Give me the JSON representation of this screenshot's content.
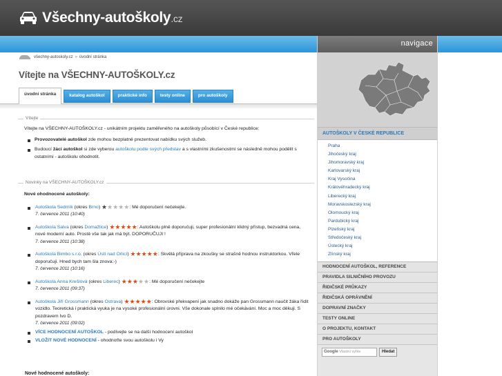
{
  "site": {
    "name": "Všechny-autoškoly",
    "tld": ".cz"
  },
  "colors": {
    "accent_blue": "#2c95d8",
    "link": "#2a78b8",
    "star_on": "#e04a10",
    "header_dark": "#3a3a3a"
  },
  "breadcrumb": {
    "home": "všechny-autoskoly.cz",
    "separator": "»",
    "current": "úvodní stránka"
  },
  "page_title": "Vítejte na VŠECHNY-AUTOŠKOLY.cz",
  "tabs": [
    {
      "label": "úvodní stránka",
      "active": true
    },
    {
      "label": "katalog autoškol",
      "active": false
    },
    {
      "label": "praktické info",
      "active": false
    },
    {
      "label": "testy online",
      "active": false
    },
    {
      "label": "pro autoškoly",
      "active": false
    }
  ],
  "welcome": {
    "legend": "Vítejte",
    "intro": "Vítejte na VŠECHNY-AUTOŠKOLY.cz - unikátním projektu zaměřeného na autoškoly působící v České republice:",
    "bullet1": {
      "bold": "Provozovatelé autoškol",
      "rest": " zde mohou bezplatně prezentovat nabídku svých služeb."
    },
    "bullet2": {
      "pre": "Budoucí ",
      "bold": "žáci autoškol",
      "mid": " si zde vyberou ",
      "link": "autoškolu podle svých představ",
      "rest": " a s vlastními zkušenostmi se následně mohou podělit s ostatními - autoškolu ohodnotit."
    }
  },
  "news": {
    "legend": "Novinky na VŠECHNY-AUTOŠKOLY.cz",
    "heading": "Nové ohodnocené autoškoly:",
    "items": [
      {
        "school": "Autoškola Sedmík",
        "okres_label": " (okres ",
        "okres": "Brno",
        "close": ")",
        "stars": 1,
        "comment": ": Mé doporučení nečekejte.",
        "date": "7. července 2011 (10:40)"
      },
      {
        "school": "Autoškola Salva",
        "okres_label": " (okres ",
        "okres": "Domažlice",
        "close": ")",
        "stars": 5,
        "comment": ": Autoškolu plně doporučuji, super profesionální klidný přístup, bezvadná cena, nové moderní auto. Prostě vše tak jak má být. DOPORUČUJI !",
        "date": "7. července 2011 (10:38)"
      },
      {
        "school": "Autoškola Bimbo s.r.o.",
        "okres_label": " (okres ",
        "okres": "Ústí nad Orlicí",
        "close": ")",
        "stars": 5,
        "comment": ": Skvělá příprava na zkoušky se strašně hodnou instruktorkou. Vřele doporučuji. Hned bych tam šla znova:-)",
        "date": "7. července 2011 (10:16)"
      },
      {
        "school": "Autoškola Anna Krešlová",
        "okres_label": " (okres ",
        "okres": "Liberec",
        "close": ")",
        "stars": 3,
        "comment": ": Mé doporučení nečekejte",
        "date": "7. července 2011 (09:37)"
      },
      {
        "school": "Autoškola Jiří Grossmann",
        "okres_label": " (okres ",
        "okres": "Ostrava",
        "close": ")",
        "stars": 5,
        "comment": ": Obrovské překvapení jak snadno dokáže pan Grossmann naučit žáka řídit vozidlo. Teoretická i praktická vyuka je na vysoké profesionální úrovni. Vše dokonale splnilo mé očekávání. Moc a moc děkuji. S pozdravem Ivo D.",
        "date": "7. července 2011 (09:02)"
      }
    ],
    "more_link": "VÍCE HODNOCENÍ AUTOŠKOL",
    "more_rest": " - podívejte se na další hodnocení autoškol",
    "rate_link": "VLOŽIT NOVÉ HODNOCENÍ",
    "rate_rest": " - ohodnoťte svou autoškolu i Vy",
    "cutoff_text": "Nové hodnocené autoškoly:"
  },
  "sidebar": {
    "title": "navigace",
    "regions_heading": "AUTOŠKOLY V ČESKÉ REPUBLICE",
    "regions": [
      "Praha",
      "Jihočeský kraj",
      "Jihomoravský kraj",
      "Karlovarský kraj",
      "Kraj Vysočina",
      "Královéhradecký kraj",
      "Liberecký kraj",
      "Moravskoslezský kraj",
      "Olomoucký kraj",
      "Pardubický kraj",
      "Plzeňský kraj",
      "Středočeský kraj",
      "Ústecký kraj",
      "Zlínský kraj"
    ],
    "links": [
      "HODNOCENÍ AUTOŠKOL, REFERENCE",
      "PRAVIDLA SILNIČNÍHO PROVOZU",
      "ŘIDIČSKÉ PRŮKAZY",
      "ŘIDIČSKÁ OPRÁVNĚNÍ",
      "DOPRAVNÍ ZNAČKY",
      "TESTY ONLINE",
      "O PROJEKTU, KONTAKT",
      "PRO AUTOŠKOLY"
    ],
    "search_brand": "Google",
    "search_placeholder": "Vlastní vyhle",
    "search_button": "Hledat"
  }
}
